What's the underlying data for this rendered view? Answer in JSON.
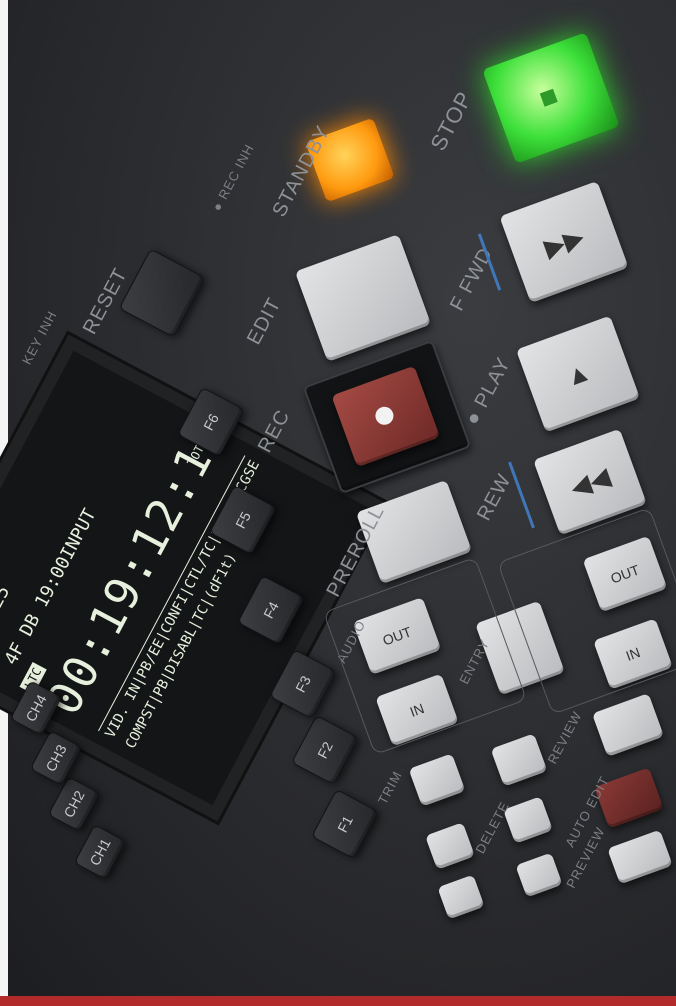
{
  "labels": {
    "stop": "STOP",
    "standby": "STANDBY",
    "rec_inh": "● REC INH",
    "ffwd": "F FWD",
    "edit": "EDIT",
    "play": "● PLAY",
    "rec": "REC",
    "rew": "REW",
    "preroll": "PREROLL",
    "reset": "RESET",
    "key_inh": "KEY INH",
    "entry": "ENTRY",
    "audio": "AUDIO",
    "trim": "TRIM",
    "review": "REVIEW",
    "auto_edit": "AUTO EDIT",
    "preview": "PREVIEW",
    "delete": "DELETE"
  },
  "keys": {
    "f1": "F1",
    "f2": "F2",
    "f3": "F3",
    "f4": "F4",
    "f5": "F5",
    "f6": "F6",
    "out": "OUT",
    "in": "IN",
    "audio_out": "OUT",
    "audio_in": "IN",
    "ch1": "CH1",
    "ch2": "CH2",
    "ch3": "CH3",
    "ch4": "CH4"
  },
  "lcd": {
    "line1": "SD   625",
    "line2": "4F  DB  19:00INPUT",
    "timecode": "00:19:12:16",
    "ltc": "LTC",
    "tc_label": "TOTL",
    "menu1": "VID. IN|PB/EE|CONFI|CTL/TC|MENU|TCGSE",
    "menu2": "COMPST|PB|DISABL|TC|(dF1t)"
  },
  "colors": {
    "stop_led": "#3de03a",
    "standby_led": "#ff9a10",
    "rec_button": "#8a3a36",
    "accent_line": "#3f77b8"
  }
}
